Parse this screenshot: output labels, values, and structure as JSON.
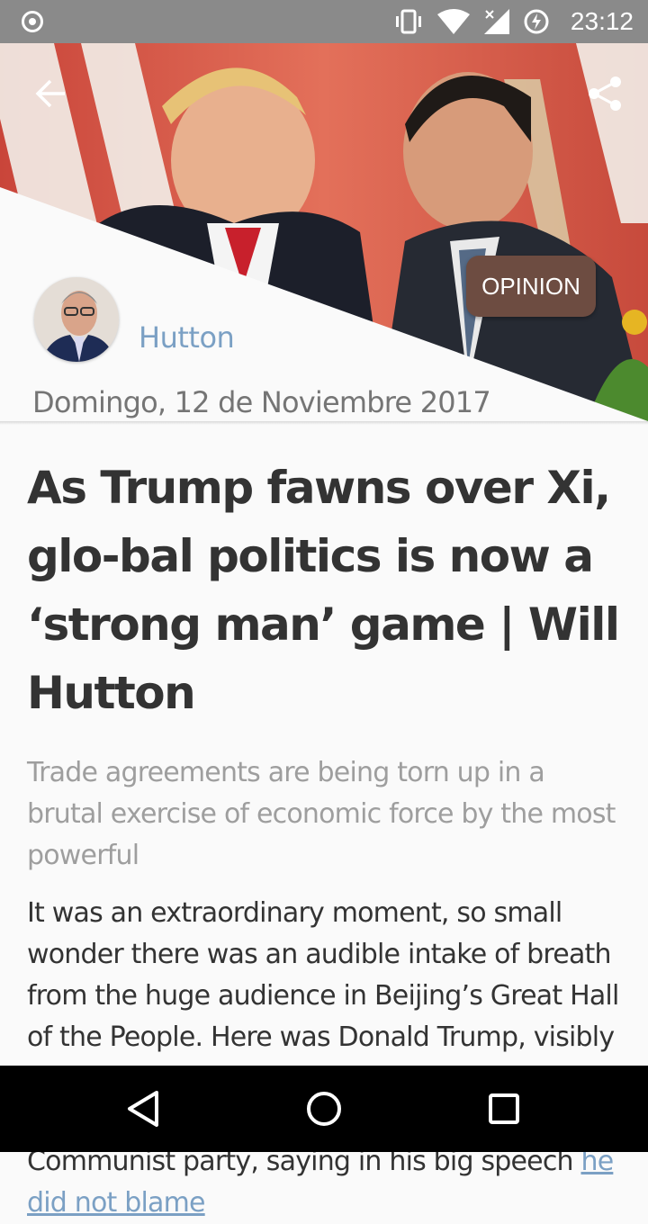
{
  "status_bar": {
    "time": "23:12"
  },
  "article": {
    "category_badge": "OPINION",
    "author_name": "Hutton",
    "date": "Domingo, 12 de Noviembre 2017",
    "title": "As Trump fawns over Xi, glo-bal politics is now a ‘strong man’ game | Will Hutton",
    "subtitle": "Trade agreements are being torn up in a brutal exercise of economic force by the most powerful",
    "body_text": "It was an extraordinary moment, so small wonder there was an audible intake of breath from the huge audience in Beijing’s Great Hall of the People. Here was Donald Trump, visibly flattered by the pomp and magnificence of the welcome mounted by the Chinese Communist party, saying in his big speech ",
    "body_link": "he did not blame"
  },
  "icons": {
    "back": "arrow-left-icon",
    "share": "share-icon",
    "nav_back": "triangle-back-icon",
    "nav_home": "circle-home-icon",
    "nav_recent": "square-recents-icon"
  },
  "colors": {
    "badge_bg": "#6d4c41",
    "author_link": "#7ba0c4",
    "status_bar": "#8a8a8a"
  }
}
